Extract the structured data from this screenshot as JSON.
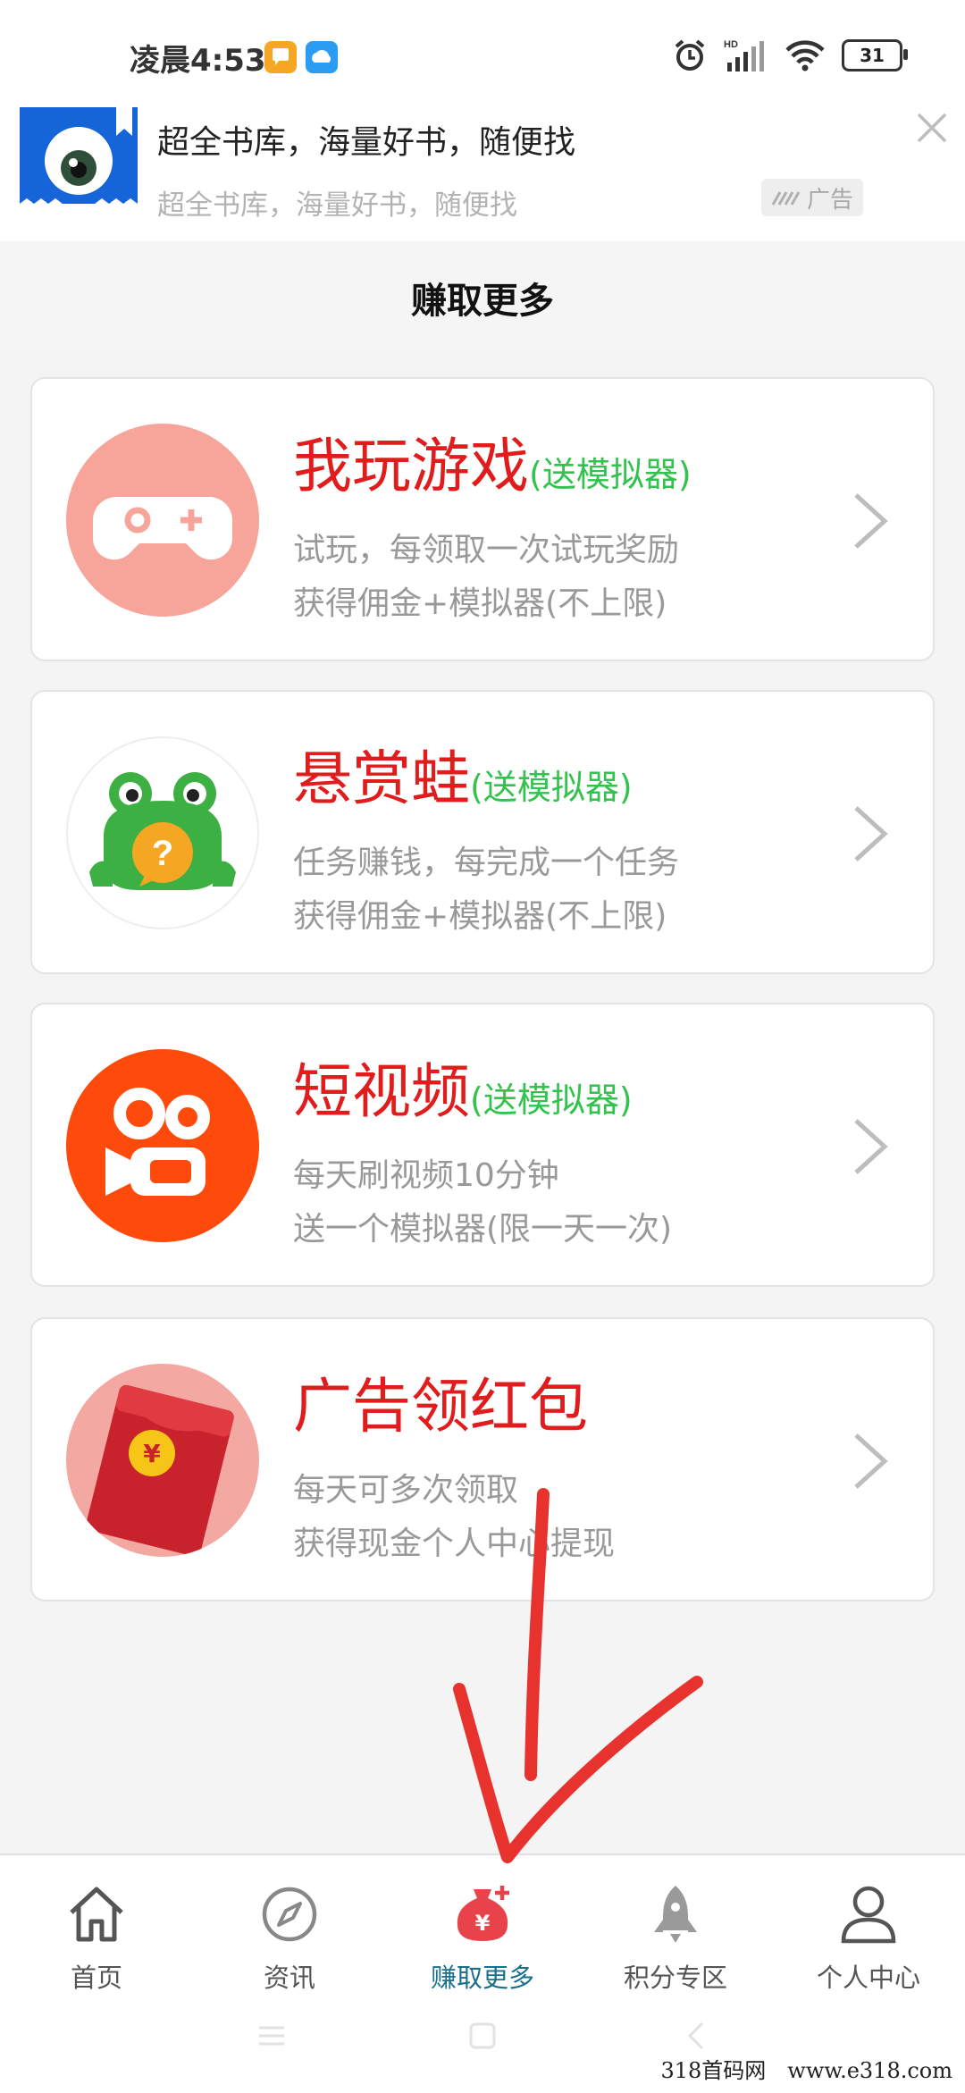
{
  "status_bar": {
    "time": "凌晨4:53",
    "battery": "31"
  },
  "ad": {
    "title": "超全书库，海量好书，随便找",
    "subtitle": "超全书库，海量好书，随便找",
    "badge": "广告"
  },
  "header": {
    "title": "赚取更多"
  },
  "cards": [
    {
      "title": "我玩游戏",
      "tag": "(送模拟器)",
      "line1": "试玩，每领取一次试玩奖励",
      "line2": "获得佣金+模拟器(不上限)",
      "icon": "gamepad-icon"
    },
    {
      "title": "悬赏蛙",
      "tag": "(送模拟器)",
      "line1": "任务赚钱，每完成一个任务",
      "line2": "获得佣金+模拟器(不上限)",
      "icon": "frog-icon"
    },
    {
      "title": "短视频",
      "tag": "(送模拟器)",
      "line1": "每天刷视频10分钟",
      "line2": "送一个模拟器(限一天一次)",
      "icon": "video-camera-icon"
    },
    {
      "title": "广告领红包",
      "tag": "",
      "line1": "每天可多次领取",
      "line2": "获得现金个人中心提现",
      "icon": "red-envelope-icon"
    }
  ],
  "nav": [
    {
      "label": "首页",
      "icon": "home-icon"
    },
    {
      "label": "资讯",
      "icon": "compass-icon"
    },
    {
      "label": "赚取更多",
      "icon": "money-bag-icon",
      "active": true
    },
    {
      "label": "积分专区",
      "icon": "rocket-icon"
    },
    {
      "label": "个人中心",
      "icon": "user-icon"
    }
  ],
  "watermark": "318首码网　www.e318.com",
  "colors": {
    "title_red": "#e01c1c",
    "tag_green": "#33c24d",
    "nav_active": "#19708c",
    "annotation_red": "#e8322e"
  }
}
